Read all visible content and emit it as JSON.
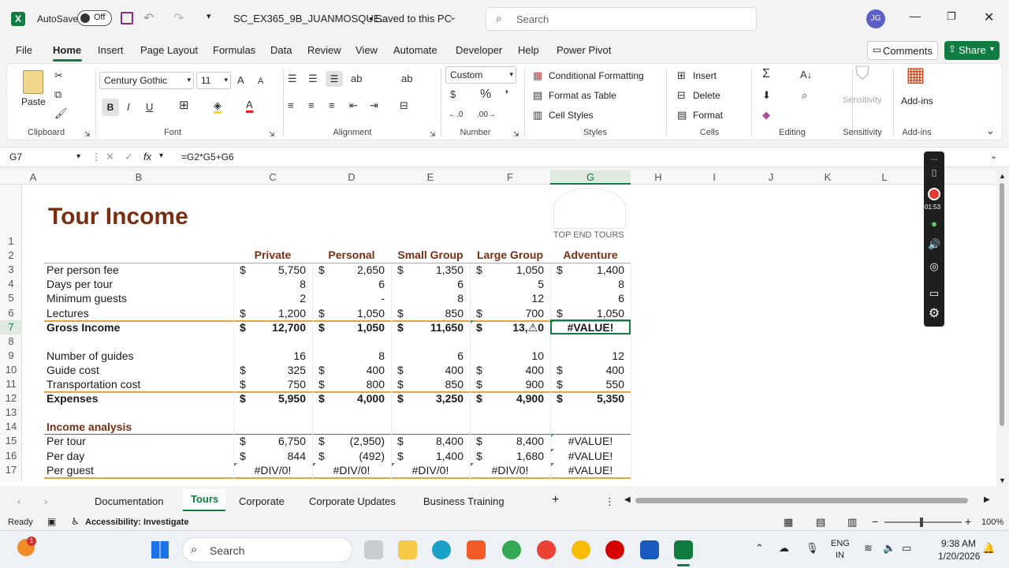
{
  "titlebar": {
    "autosave": "AutoSave",
    "toggle": "Off",
    "filename": "SC_EX365_9B_JUANMOSQUE...",
    "saved": "• Saved to this PC",
    "search_placeholder": "Search",
    "avatar": "JG"
  },
  "menu": {
    "items": [
      "File",
      "Home",
      "Insert",
      "Page Layout",
      "Formulas",
      "Data",
      "Review",
      "View",
      "Automate",
      "Developer",
      "Help",
      "Power Pivot"
    ],
    "comments": "Comments",
    "share": "Share"
  },
  "ribbon": {
    "paste": "Paste",
    "font_name": "Century Gothic",
    "font_size": "11",
    "number_format": "Custom",
    "cond_fmt": "Conditional Formatting",
    "format_table": "Format as Table",
    "cell_styles": "Cell Styles",
    "insert": "Insert",
    "delete": "Delete",
    "format": "Format",
    "sensitivity": "Sensitivity",
    "addins": "Add-ins",
    "groups": {
      "clipboard": "Clipboard",
      "font": "Font",
      "alignment": "Alignment",
      "number": "Number",
      "styles": "Styles",
      "cells": "Cells",
      "editing": "Editing",
      "sensitivity": "Sensitivity",
      "addins": "Add-ins"
    }
  },
  "formula_bar": {
    "cell_ref": "G7",
    "fx": "fx",
    "formula": "=G2*G5+G6"
  },
  "columns": [
    "A",
    "B",
    "C",
    "D",
    "E",
    "F",
    "G",
    "H",
    "I",
    "J",
    "K",
    "L"
  ],
  "sheet": {
    "title": "Tour Income",
    "logo_text": "TOP END TOURS",
    "headers": [
      "Private",
      "Personal",
      "Small Group",
      "Large Group",
      "Adventure"
    ],
    "rows": [
      {
        "n": "1",
        "label": "",
        "v": [
          "",
          "",
          "",
          "",
          ""
        ],
        "d": [
          false,
          false,
          false,
          false,
          false
        ]
      },
      {
        "n": "2",
        "label": "",
        "v": [
          "",
          "",
          "",
          "",
          ""
        ],
        "d": [
          false,
          false,
          false,
          false,
          false
        ]
      },
      {
        "n": "3",
        "label": "Per person fee",
        "v": [
          "5,750",
          "2,650",
          "1,350",
          "1,050",
          "1,400"
        ],
        "d": [
          true,
          true,
          true,
          true,
          true
        ]
      },
      {
        "n": "4",
        "label": "Days per tour",
        "v": [
          "8",
          "6",
          "6",
          "5",
          "8"
        ],
        "d": [
          false,
          false,
          false,
          false,
          false
        ]
      },
      {
        "n": "5",
        "label": "Minimum guests",
        "v": [
          "2",
          "-",
          "8",
          "12",
          "6"
        ],
        "d": [
          false,
          false,
          false,
          false,
          false
        ]
      },
      {
        "n": "6",
        "label": "Lectures",
        "v": [
          "1,200",
          "1,050",
          "850",
          "700",
          "1,050"
        ],
        "d": [
          true,
          true,
          true,
          true,
          true
        ]
      },
      {
        "n": "7",
        "label": "Gross Income",
        "v": [
          "12,700",
          "1,050",
          "11,650",
          "13,⚠0",
          "#VALUE!"
        ],
        "d": [
          true,
          true,
          true,
          true,
          false
        ],
        "bold": true
      },
      {
        "n": "8",
        "label": "",
        "v": [
          "",
          "",
          "",
          "",
          ""
        ],
        "d": [
          false,
          false,
          false,
          false,
          false
        ]
      },
      {
        "n": "9",
        "label": "Number of guides",
        "v": [
          "16",
          "8",
          "6",
          "10",
          "12"
        ],
        "d": [
          false,
          false,
          false,
          false,
          false
        ]
      },
      {
        "n": "10",
        "label": "Guide cost",
        "v": [
          "325",
          "400",
          "400",
          "400",
          "400"
        ],
        "d": [
          true,
          true,
          true,
          true,
          true
        ]
      },
      {
        "n": "11",
        "label": "Transportation cost",
        "v": [
          "750",
          "800",
          "850",
          "900",
          "550"
        ],
        "d": [
          true,
          true,
          true,
          true,
          true
        ]
      },
      {
        "n": "12",
        "label": "Expenses",
        "v": [
          "5,950",
          "4,000",
          "3,250",
          "4,900",
          "5,350"
        ],
        "d": [
          true,
          true,
          true,
          true,
          true
        ],
        "bold": true
      },
      {
        "n": "13",
        "label": "",
        "v": [
          "",
          "",
          "",
          "",
          ""
        ],
        "d": [
          false,
          false,
          false,
          false,
          false
        ]
      },
      {
        "n": "14",
        "label": "Income analysis",
        "v": [
          "",
          "",
          "",
          "",
          ""
        ],
        "d": [
          false,
          false,
          false,
          false,
          false
        ],
        "section": true
      },
      {
        "n": "15",
        "label": "Per tour",
        "v": [
          "6,750",
          "(2,950)",
          "8,400",
          "8,400",
          "#VALUE!"
        ],
        "d": [
          true,
          true,
          true,
          true,
          false
        ]
      },
      {
        "n": "16",
        "label": "Per day",
        "v": [
          "844",
          "(492)",
          "1,400",
          "1,680",
          "#VALUE!"
        ],
        "d": [
          true,
          true,
          true,
          true,
          false
        ]
      },
      {
        "n": "17",
        "label": "Per guest",
        "v": [
          "#DIV/0!",
          "#DIV/0!",
          "#DIV/0!",
          "#DIV/0!",
          "#VALUE!"
        ],
        "d": [
          false,
          false,
          false,
          false,
          false
        ]
      }
    ],
    "dollar": "$"
  },
  "sheet_tabs": [
    "Documentation",
    "Tours",
    "Corporate",
    "Corporate Updates",
    "Business Training"
  ],
  "status": {
    "ready": "Ready",
    "accessibility": "Accessibility: Investigate",
    "zoom": "100%"
  },
  "taskbar": {
    "search": "Search",
    "lang1": "ENG",
    "lang2": "IN",
    "time": "9:38 AM",
    "date": "1/20/2026"
  },
  "recorder": {
    "timer": "01:53"
  },
  "colors": {
    "excel_green": "#107c41",
    "header_brown": "#7a2f10",
    "accent_orange": "#e8a33d"
  }
}
